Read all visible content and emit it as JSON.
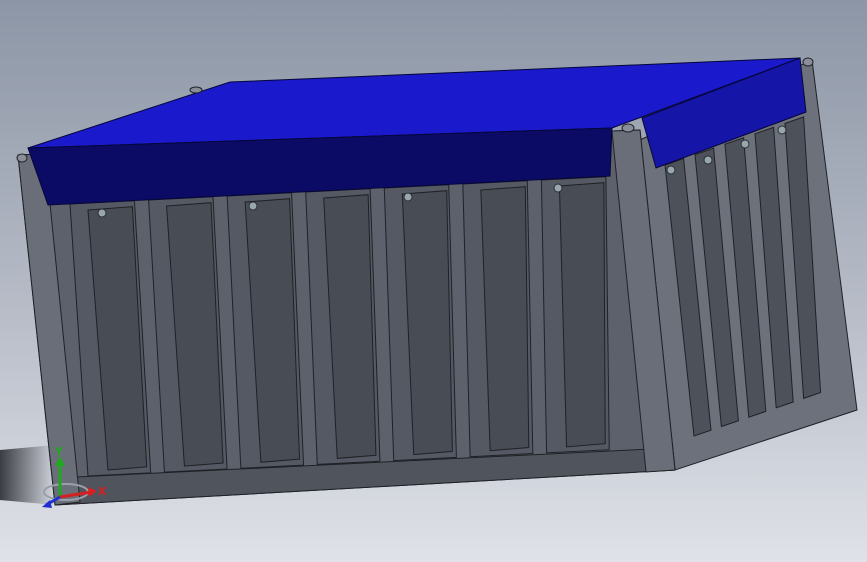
{
  "viewport": {
    "background_top": "#8c96a6",
    "background_bottom": "#dfe2e8"
  },
  "model": {
    "body_color": "#5b5f6a",
    "panel_color": "#4c5059",
    "side_color": "#6d717c",
    "lid_top_color": "#1a1acc",
    "lid_front_color": "#0b0b66",
    "lid_side_color": "#1515a8",
    "front_slot_count": 7,
    "side_slot_count": 5
  },
  "triad": {
    "x_label": "X",
    "y_label": "Y",
    "z_label": "Z",
    "x_color": "#d42020",
    "y_color": "#1fa91f",
    "z_color": "#2030d0"
  }
}
